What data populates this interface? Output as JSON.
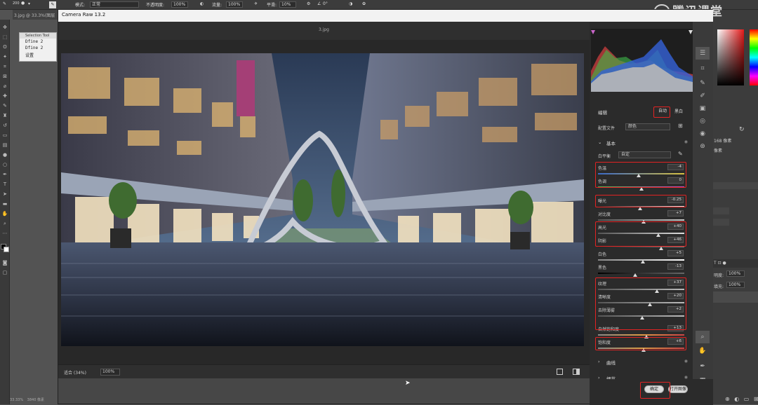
{
  "ps_toolbar": {
    "brush_size": "200",
    "mode_label": "模式:",
    "mode_value": "正常",
    "opacity_label": "不透明度:",
    "opacity_value": "100%",
    "flow_label": "流量:",
    "flow_value": "100%",
    "smooth_label": "平滑:",
    "smooth_value": "10%",
    "angle_value": "0°"
  },
  "ps_doc_tab": "3.jpg @ 33.3%(图层",
  "selection_tool_panel": {
    "header": "Selection Tool",
    "item1": "Dfine 2",
    "item2": "Dfine 2",
    "item3": "设置"
  },
  "ps_status": {
    "zoom": "33.33%",
    "doc": "3840 像素"
  },
  "ps_right": {
    "px_label": "168 像素",
    "px_label2": "像素",
    "opacity_label": "明度:",
    "opacity_value": "100%",
    "fill_label": "填充:",
    "fill_value": "100%"
  },
  "watermark": "腾讯课堂",
  "camera_raw": {
    "title": "Camera Raw 13.2",
    "filename": "3.jpg",
    "zoom_fit": "适合 (34%)",
    "zoom_pct": "100%",
    "edit_label": "编辑",
    "auto_btn": "自动",
    "bw_btn": "黑白",
    "profile_label": "配置文件",
    "profile_value": "颜色",
    "section_basic": "基本",
    "wb_label": "白平衡",
    "wb_value": "自定",
    "sliders": {
      "temp": {
        "label": "色温",
        "value": "-4"
      },
      "tint": {
        "label": "色调",
        "value": "0"
      },
      "exposure": {
        "label": "曝光",
        "value": "-0.25"
      },
      "contrast": {
        "label": "对比度",
        "value": "+7"
      },
      "highlights": {
        "label": "高光",
        "value": "+40"
      },
      "shadows": {
        "label": "阴影",
        "value": "+46"
      },
      "whites": {
        "label": "白色",
        "value": "+5"
      },
      "blacks": {
        "label": "黑色",
        "value": "-13"
      },
      "texture": {
        "label": "纹理",
        "value": "+37"
      },
      "clarity": {
        "label": "清晰度",
        "value": "+20"
      },
      "dehaze": {
        "label": "去除薄雾",
        "value": "+2"
      },
      "vibrance": {
        "label": "自然饱和度",
        "value": "+13"
      },
      "saturation": {
        "label": "饱和度",
        "value": "+6"
      }
    },
    "section_curve": "曲线",
    "section_detail": "细节",
    "ok_btn": "确定",
    "cancel_btn": "取消",
    "open_btn": "打开图像"
  },
  "colors": {
    "highlight_red": "#e32323",
    "panel_bg": "#2b2b2b",
    "accent_blue": "#2c7be5"
  }
}
